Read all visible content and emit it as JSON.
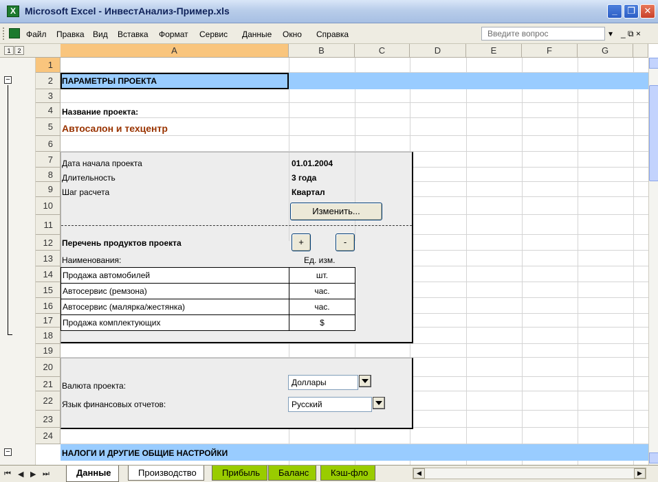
{
  "window": {
    "title": "Microsoft Excel - ИнвестАнализ-Пример.xls",
    "app_icon": "excel-icon",
    "controls": [
      "minimize-icon",
      "restore-icon",
      "close-icon"
    ]
  },
  "menu": {
    "items": [
      "Файл",
      "Правка",
      "Вид",
      "Вставка",
      "Формат",
      "Сервис",
      "Данные",
      "Окно",
      "Справка"
    ],
    "ask_placeholder": "Введите вопрос",
    "ask_dropdown": "▾",
    "restore_glyph": "_ ⧉ ×"
  },
  "grid": {
    "outline_levels": [
      "1",
      "2"
    ],
    "columns": [
      "A",
      "B",
      "C",
      "D",
      "E",
      "F",
      "G"
    ],
    "active_column": "A",
    "rows": [
      "1",
      "2",
      "3",
      "4",
      "5",
      "6",
      "7",
      "8",
      "9",
      "10",
      "11",
      "12",
      "13",
      "14",
      "15",
      "16",
      "17",
      "18",
      "19",
      "20",
      "21",
      "22",
      "23",
      "24"
    ],
    "active_row": "1"
  },
  "sheet": {
    "section1_title": "ПАРАМЕТРЫ ПРОЕКТА",
    "project_name_label": "Название проекта:",
    "project_name_value": "Автосалон и техцентр",
    "start_date_label": "Дата начала проекта",
    "start_date_value": "01.01.2004",
    "duration_label": "Длительность",
    "duration_value": "3 года",
    "step_label": "Шаг расчета",
    "step_value": "Квартал",
    "change_button": "Изменить...",
    "products_title": "Перечень продуктов проекта",
    "add_button": "+",
    "remove_button": "-",
    "products_header_name": "Наименования:",
    "products_header_unit": "Ед. изм.",
    "products": [
      {
        "name": "Продажа автомобилей",
        "unit": "шт."
      },
      {
        "name": "Автосервис (ремзона)",
        "unit": "час."
      },
      {
        "name": "Автосервис (малярка/жестянка)",
        "unit": "час."
      },
      {
        "name": "Продажа комплектующих",
        "unit": "$"
      }
    ],
    "currency_label": "Валюта проекта:",
    "currency_value": "Доллары",
    "language_label": "Язык финансовых отчетов:",
    "language_value": "Русский",
    "section2_title": "НАЛОГИ И ДРУГИЕ ОБЩИЕ НАСТРОЙКИ"
  },
  "tabs": {
    "nav": [
      "⏮",
      "◀",
      "▶",
      "⏭"
    ],
    "sheets": [
      {
        "label": "Данные",
        "active": true,
        "color": "#ffffff"
      },
      {
        "label": "Производство",
        "active": false,
        "color": "#ffffff"
      },
      {
        "label": "Прибыль",
        "active": false,
        "color": "#99cc00"
      },
      {
        "label": "Баланс",
        "active": false,
        "color": "#99cc00"
      },
      {
        "label": "Кэш-фло",
        "active": false,
        "color": "#99cc00"
      }
    ]
  },
  "colors": {
    "band": "#99ccff",
    "project_name": "#993300",
    "panel": "#ededed",
    "active_header": "#f9c57d"
  }
}
